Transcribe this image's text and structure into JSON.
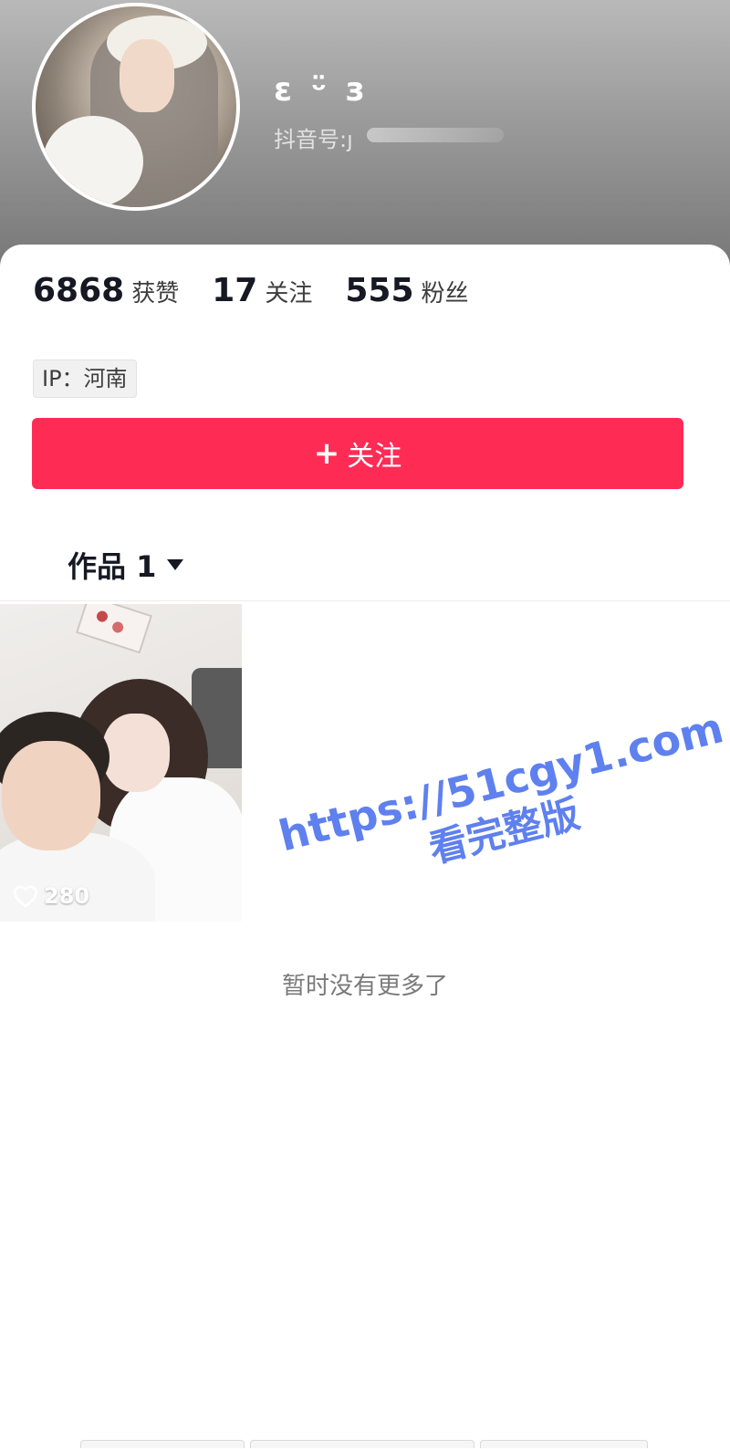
{
  "profile": {
    "username": "ε ᵕ̈ з",
    "douyin_id_label": "抖音号:",
    "douyin_id_value": "ȷ",
    "ip_label": "IP：河南"
  },
  "stats": {
    "likes_count": "6868",
    "likes_label": "获赞",
    "following_count": "17",
    "following_label": "关注",
    "followers_count": "555",
    "followers_label": "粉丝"
  },
  "actions": {
    "follow_plus": "+",
    "follow_label": "关注"
  },
  "tabs": {
    "works_label": "作品 1"
  },
  "videos": [
    {
      "likes": "280"
    }
  ],
  "footer": {
    "no_more_text": "暂时没有更多了"
  },
  "watermark": {
    "url": "https://51cgy1.com",
    "subtitle": "看完整版"
  },
  "colors": {
    "accent": "#fe2c55",
    "watermark": "#5f80ef"
  },
  "icons": {
    "heart": "heart-outline-icon",
    "dropdown": "caret-down-icon"
  }
}
